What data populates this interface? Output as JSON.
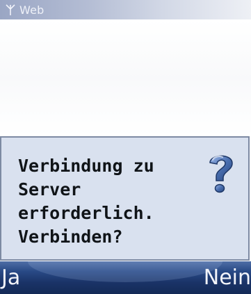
{
  "statusbar": {
    "icon": "signal-antenna-icon",
    "title": "Web"
  },
  "dialog": {
    "message": "Verbindung zu\nServer\nerforderlich.\nVerbinden?",
    "icon": "question-icon",
    "icon_color": "#4a6fb0"
  },
  "softkeys": {
    "left": "Ja",
    "right": "Nein"
  },
  "colors": {
    "dialog_bg": "#d9e1ef",
    "softkey_bar": "#1a3367"
  }
}
